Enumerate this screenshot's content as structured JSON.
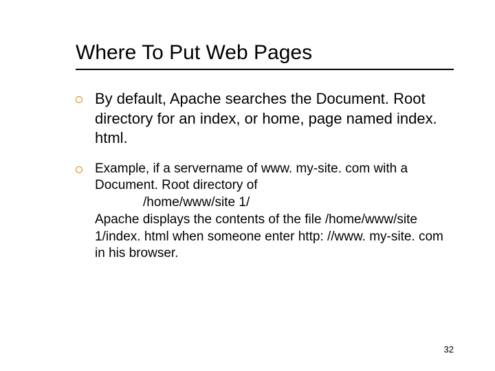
{
  "title": "Where To Put  Web Pages",
  "bullets": [
    {
      "text": "By default, Apache searches the Document. Root directory for an index, or home, page named index. html.",
      "class": "b1"
    },
    {
      "text_parts": {
        "line1": "Example, if a servername of www. my-site. com with a Document. Root directory of",
        "indent": "/home/www/site 1/",
        "line2": " Apache displays the contents of the file /home/www/site 1/index. html when someone enter  http: //www. my-site. com in his browser."
      },
      "class": "b2"
    }
  ],
  "page_number": "32"
}
